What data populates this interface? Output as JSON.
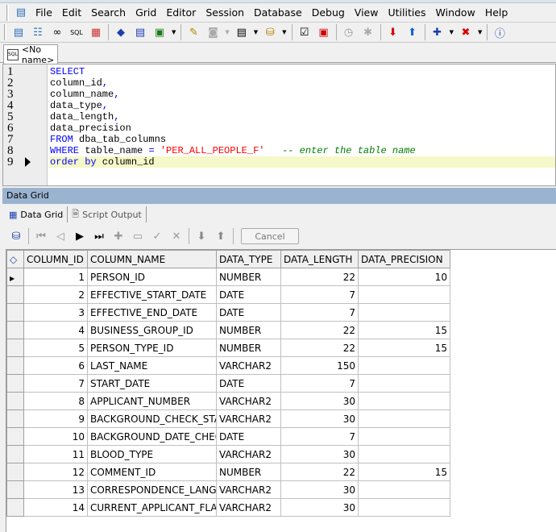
{
  "menu": [
    "File",
    "Edit",
    "Search",
    "Grid",
    "Editor",
    "Session",
    "Database",
    "Debug",
    "View",
    "Utilities",
    "Window",
    "Help"
  ],
  "document_tab": "<No name>",
  "code_lines": [
    [
      {
        "t": "kw",
        "v": "SELECT"
      }
    ],
    [
      {
        "t": "id",
        "v": "column_id"
      },
      {
        "t": "pn",
        "v": ","
      }
    ],
    [
      {
        "t": "id",
        "v": "column_name"
      },
      {
        "t": "pn",
        "v": ","
      }
    ],
    [
      {
        "t": "id",
        "v": "data_type"
      },
      {
        "t": "pn",
        "v": ","
      }
    ],
    [
      {
        "t": "id",
        "v": "data_length"
      },
      {
        "t": "pn",
        "v": ","
      }
    ],
    [
      {
        "t": "id",
        "v": "data_precision"
      }
    ],
    [
      {
        "t": "kw",
        "v": "FROM"
      },
      {
        "t": "id",
        "v": " dba_tab_columns"
      }
    ],
    [
      {
        "t": "kw",
        "v": "WHERE"
      },
      {
        "t": "id",
        "v": " table_name "
      },
      {
        "t": "pn",
        "v": "="
      },
      {
        "t": "id",
        "v": " "
      },
      {
        "t": "str",
        "v": "'PER_ALL_PEOPLE_F'"
      },
      {
        "t": "id",
        "v": "   "
      },
      {
        "t": "cm",
        "v": "-- enter the table name"
      }
    ],
    [
      {
        "t": "kw",
        "v": "order by"
      },
      {
        "t": "id",
        "v": " column_id"
      }
    ]
  ],
  "panel_title": "Data Grid",
  "subtabs": [
    "Data Grid",
    "Script Output"
  ],
  "cancel_label": "Cancel",
  "columns": [
    "COLUMN_ID",
    "COLUMN_NAME",
    "DATA_TYPE",
    "DATA_LENGTH",
    "DATA_PRECISION"
  ],
  "rows": [
    [
      "1",
      "PERSON_ID",
      "NUMBER",
      "22",
      "10"
    ],
    [
      "2",
      "EFFECTIVE_START_DATE",
      "DATE",
      "7",
      ""
    ],
    [
      "3",
      "EFFECTIVE_END_DATE",
      "DATE",
      "7",
      ""
    ],
    [
      "4",
      "BUSINESS_GROUP_ID",
      "NUMBER",
      "22",
      "15"
    ],
    [
      "5",
      "PERSON_TYPE_ID",
      "NUMBER",
      "22",
      "15"
    ],
    [
      "6",
      "LAST_NAME",
      "VARCHAR2",
      "150",
      ""
    ],
    [
      "7",
      "START_DATE",
      "DATE",
      "7",
      ""
    ],
    [
      "8",
      "APPLICANT_NUMBER",
      "VARCHAR2",
      "30",
      ""
    ],
    [
      "9",
      "BACKGROUND_CHECK_STATUS",
      "VARCHAR2",
      "30",
      ""
    ],
    [
      "10",
      "BACKGROUND_DATE_CHECK",
      "DATE",
      "7",
      ""
    ],
    [
      "11",
      "BLOOD_TYPE",
      "VARCHAR2",
      "30",
      ""
    ],
    [
      "12",
      "COMMENT_ID",
      "NUMBER",
      "22",
      "15"
    ],
    [
      "13",
      "CORRESPONDENCE_LANGUAGE",
      "VARCHAR2",
      "30",
      ""
    ],
    [
      "14",
      "CURRENT_APPLICANT_FLAG",
      "VARCHAR2",
      "30",
      ""
    ]
  ]
}
